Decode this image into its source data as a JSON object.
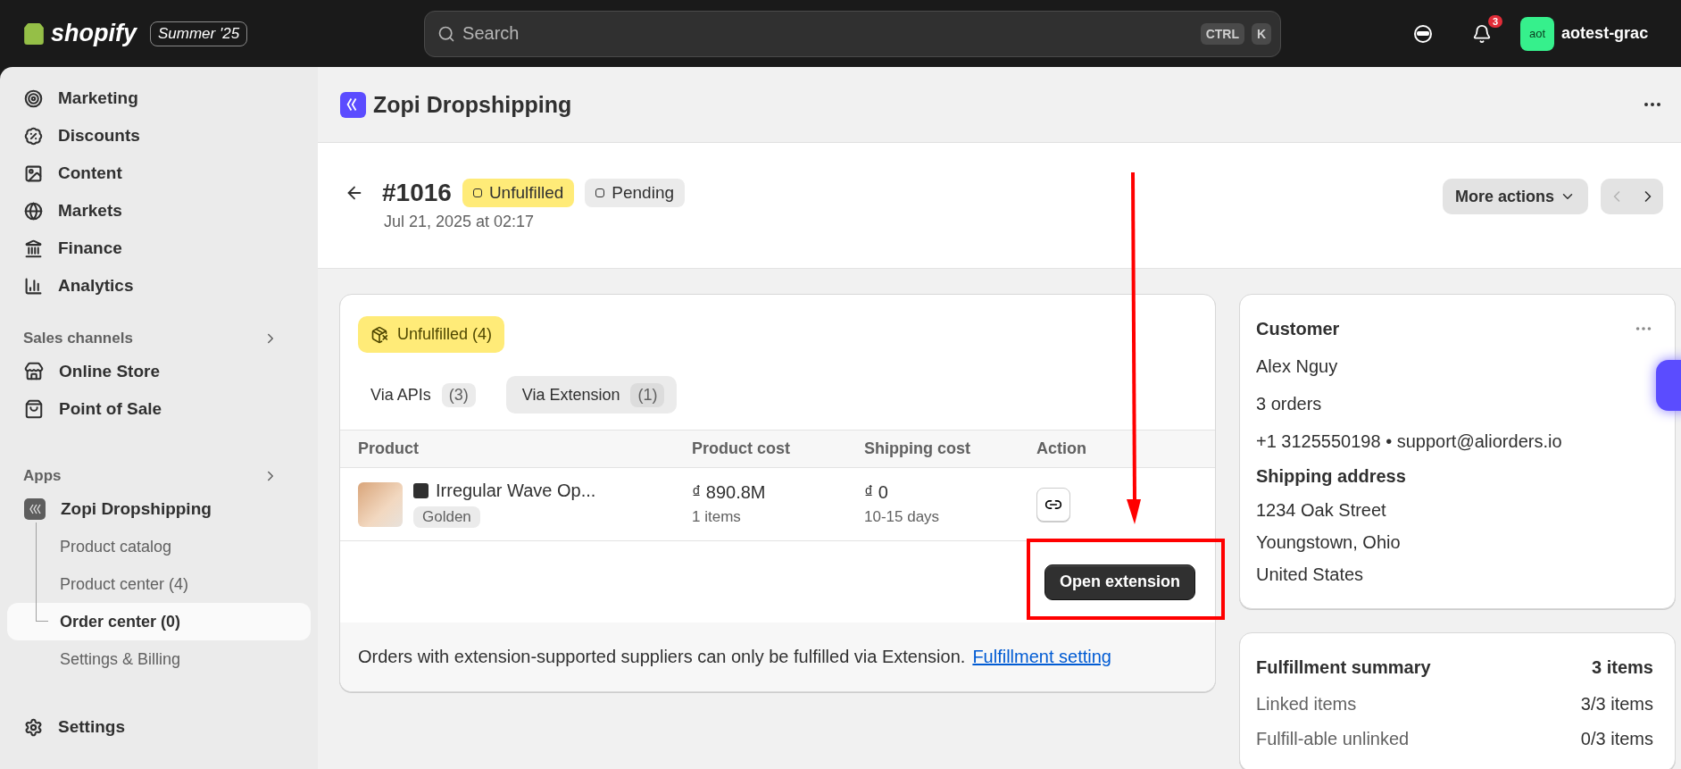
{
  "topbar": {
    "logo": "shopify",
    "edition": "Summer '25",
    "search": {
      "placeholder": "Search",
      "keys": [
        "CTRL",
        "K"
      ]
    },
    "notifications": "3",
    "avatar": "aot",
    "store": "aotest-grac"
  },
  "sidebar": {
    "items": [
      {
        "label": "Marketing"
      },
      {
        "label": "Discounts"
      },
      {
        "label": "Content"
      },
      {
        "label": "Markets"
      },
      {
        "label": "Finance"
      },
      {
        "label": "Analytics"
      }
    ],
    "sections": [
      {
        "title": "Sales channels",
        "items": [
          {
            "label": "Online Store"
          },
          {
            "label": "Point of Sale"
          }
        ]
      },
      {
        "title": "Apps",
        "items": [
          {
            "label": "Zopi Dropshipping",
            "children": [
              {
                "label": "Product catalog",
                "selected": false
              },
              {
                "label": "Product center (4)",
                "selected": false
              },
              {
                "label": "Order center (0)",
                "selected": true
              },
              {
                "label": "Settings & Billing",
                "selected": false
              }
            ]
          }
        ]
      }
    ],
    "footer": {
      "label": "Settings"
    }
  },
  "app_header": {
    "title": "Zopi Dropshipping"
  },
  "order": {
    "number": "#1016",
    "badges": [
      {
        "label": "Unfulfilled",
        "color": "#ffeb78"
      },
      {
        "label": "Pending",
        "color": "#ebebeb"
      }
    ],
    "date": "Jul 21, 2025 at 02:17",
    "more_actions": "More actions"
  },
  "fulfillment_card": {
    "status": "Unfulfilled (4)",
    "tabs": [
      {
        "label": "Via APIs",
        "count": "(3)",
        "selected": false
      },
      {
        "label": "Via Extension",
        "count": "(1)",
        "selected": true
      }
    ],
    "table": {
      "columns": [
        "Product",
        "Product cost",
        "Shipping cost",
        "Action"
      ],
      "rows": [
        {
          "product": "Irregular Wave Op...",
          "variant": "Golden",
          "product_cost": "₫ 890.8M",
          "quantity": "1 items",
          "shipping_cost": "₫ 0",
          "shipping_time": "10-15 days"
        }
      ]
    },
    "button": "Open extension",
    "note": "Orders with extension-supported suppliers can only be fulfilled via Extension.",
    "note_link": "Fulfillment setting"
  },
  "customer_card": {
    "title": "Customer",
    "lines": [
      "Alex Nguy",
      "3 orders",
      "+1 3125550198 • support@aliorders.io"
    ],
    "address_title": "Shipping address",
    "address": [
      "1234 Oak Street",
      "Youngstown, Ohio",
      "United States"
    ]
  },
  "summary_card": {
    "title": "Fulfillment summary",
    "total": "3 items",
    "rows": [
      {
        "label": "Linked items",
        "value": "3/3 items"
      },
      {
        "label": "Fulfill-able unlinked",
        "value": "0/3 items"
      }
    ]
  }
}
